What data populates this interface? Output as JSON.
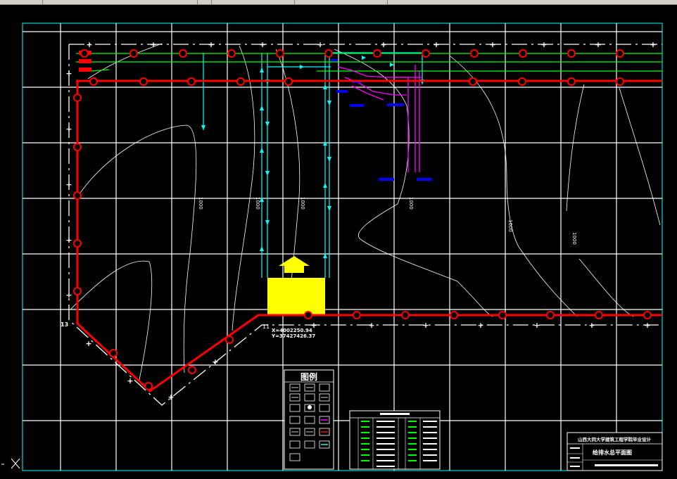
{
  "window": {
    "toolbar_visible": true,
    "background_color": "#000000"
  },
  "drawing": {
    "line_colors": {
      "grid": "#ffffff",
      "border": "#00ffff",
      "site_boundary": "#ffffff",
      "pipe_red": "#ff0000",
      "pipe_green": "#00ff00",
      "pipe_cyan": "#00ffff",
      "pipe_magenta": "#ff00ff",
      "fitting_blue": "#0000ff",
      "building_fill": "#ffff00"
    },
    "coordinate_note_line1": "X=4002250.94",
    "coordinate_note_line2": "Y=37427426.37",
    "corner_label": "13",
    "point_label": "11",
    "contour_labels": [
      "1000",
      "1000",
      "1000",
      "1000",
      "1000",
      "1000"
    ]
  },
  "legend": {
    "title": "图例"
  },
  "title_block": {
    "project_title": "山西大同大学建筑工程学院毕业设计",
    "drawing_title": "给排水总平面图"
  }
}
